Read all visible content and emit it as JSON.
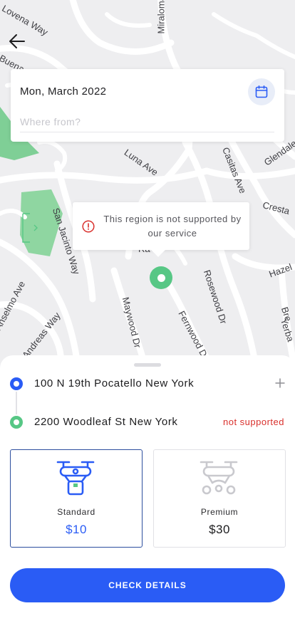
{
  "map": {
    "streets": [
      "Lovena Way",
      "Buena Ave",
      "Miraloma",
      "Luna Ave",
      "Casitas Ave",
      "Glendale Ave",
      "Cresta",
      "San Jacinto Way",
      "Hazel",
      "Anselmo Ave",
      "Andreas Way",
      "Maywood Dr",
      "Rosewood Dr",
      "Fernwood Dr",
      "Yerba",
      "Bre",
      "Ra"
    ],
    "notice": "This region is not supported by our service",
    "pin_color": "#57c785"
  },
  "header": {
    "back_icon": "arrow-left-icon"
  },
  "search": {
    "date": "Mon, March 2022",
    "calendar_icon": "calendar-icon",
    "from_placeholder": "Where from?",
    "from_value": ""
  },
  "route": {
    "pickup": "100 N 19th Pocatello New York",
    "dropoff": "2200 Woodleaf St New York",
    "add_stop_icon": "plus-icon",
    "dropoff_status": "not supported"
  },
  "tiers": [
    {
      "name": "Standard",
      "price": "$10",
      "selected": true,
      "icon": "drone-package-icon"
    },
    {
      "name": "Premium",
      "price": "$30",
      "selected": false,
      "icon": "drone-icon"
    }
  ],
  "cta": {
    "label": "CHECK DETAILS"
  },
  "colors": {
    "primary": "#2a5cf5",
    "success": "#57c785",
    "error": "#d9302c",
    "selected_border": "#2c4e9e"
  }
}
